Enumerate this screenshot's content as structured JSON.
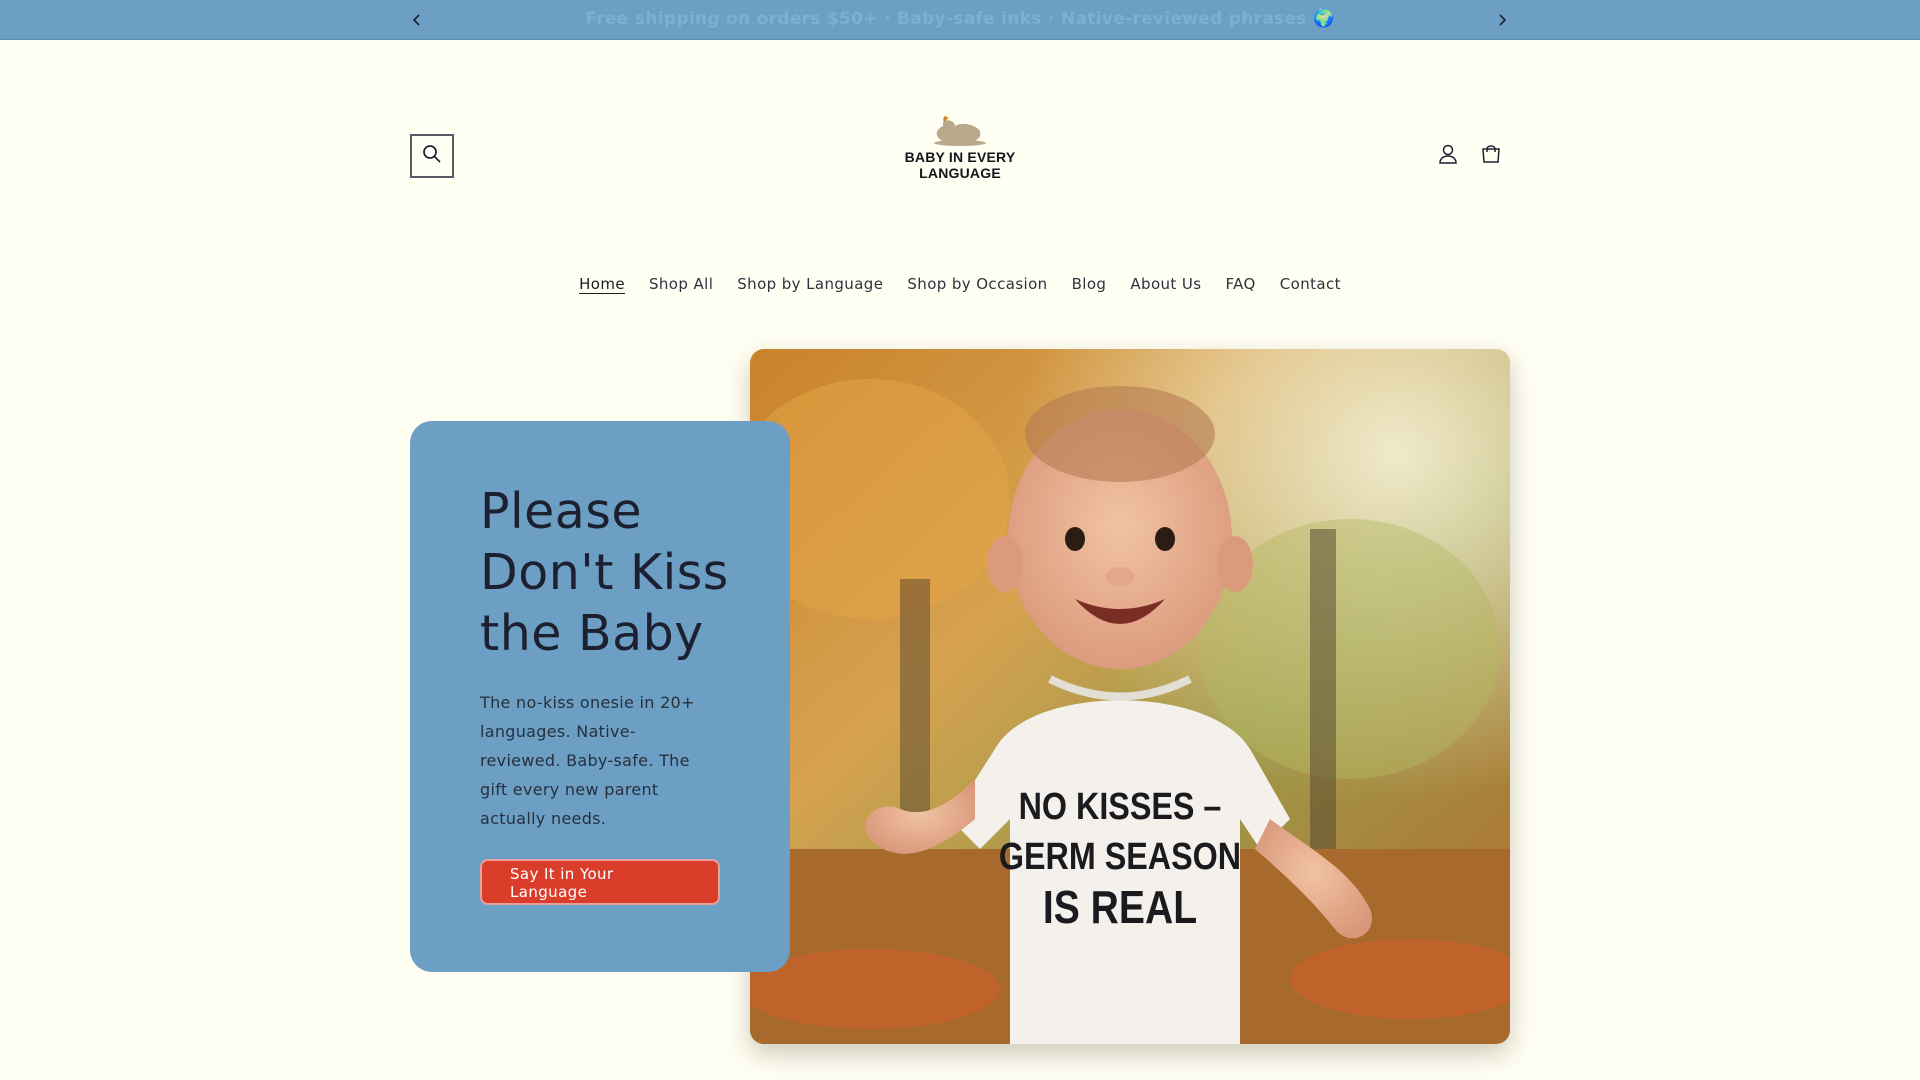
{
  "announcement": {
    "message": "Free shipping on orders $50+ · Baby-safe inks · Native-reviewed phrases 🌍",
    "prev_icon": "chevron-left-icon",
    "next_icon": "chevron-right-icon"
  },
  "header": {
    "brand_line1": "BABY IN EVERY",
    "brand_line2": "LANGUAGE",
    "search_icon": "search-icon",
    "account_icon": "user-icon",
    "cart_icon": "cart-icon"
  },
  "nav": {
    "items": [
      "Home",
      "Shop All",
      "Shop by Language",
      "Shop by Occasion",
      "Blog",
      "About Us",
      "FAQ",
      "Contact"
    ],
    "active": "Home"
  },
  "hero": {
    "title": "Please Don't Kiss the Baby",
    "description": "The no-kiss onesie in 20+ languages. Native-reviewed. Baby-safe. The gift every new parent actually needs.",
    "cta_label": "Say It in Your Language",
    "onesie_text": [
      "NO KISSES –",
      "GERM SEASON",
      "IS REAL"
    ]
  },
  "colors": {
    "page_bg": "#fffef2",
    "accent_blue": "#6c9fc3",
    "cta_red": "#db3d2b",
    "text_dark": "#1c2030"
  }
}
